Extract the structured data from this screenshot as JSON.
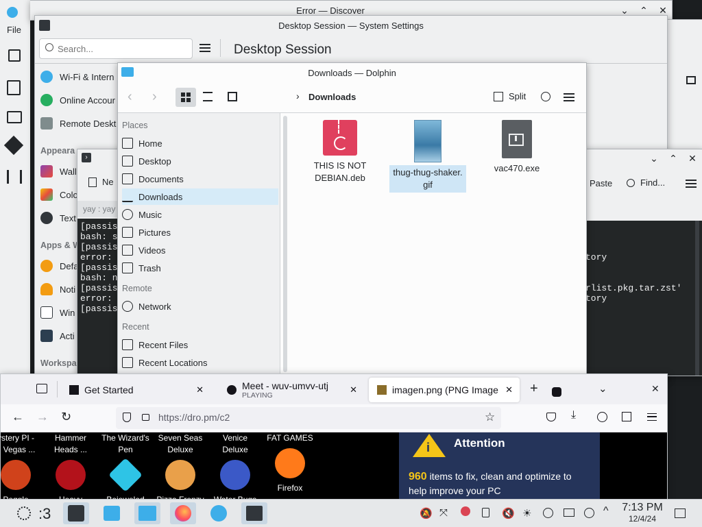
{
  "discover": {
    "title": "Error — Discover",
    "menu_file": "File"
  },
  "settings": {
    "title": "Desktop Session — System Settings",
    "search_placeholder": "Search...",
    "page_title": "Desktop Session",
    "items": [
      {
        "label": "Wi-Fi & Intern",
        "icon": "wifi-icon"
      },
      {
        "label": "Online Accour",
        "icon": "globe-icon"
      },
      {
        "label": "Remote Deskt",
        "icon": "remote-desktop-icon"
      }
    ],
    "section_appearance": "Appeara",
    "appearance_items": [
      {
        "label": "Wall",
        "icon": "wallpaper-icon"
      },
      {
        "label": "Colo",
        "icon": "colors-icon"
      },
      {
        "label": "Text",
        "icon": "text-icon"
      }
    ],
    "section_apps": "Apps & W",
    "apps_items": [
      {
        "label": "Defa",
        "icon": "star-icon"
      },
      {
        "label": "Noti",
        "icon": "bell-icon"
      },
      {
        "label": "Win",
        "icon": "window-icon"
      },
      {
        "label": "Acti",
        "icon": "activities-icon"
      }
    ],
    "section_workspace": "Workspa"
  },
  "konsole": {
    "new_tab": "Ne",
    "tab_label": "yay : yay",
    "lines": [
      "[passis",
      "bash: s",
      "[passis",
      "error: ",
      "[passis",
      "bash: n",
      "[passis",
      "error: ",
      "[passis"
    ]
  },
  "bg_terminal": {
    "paste": "Paste",
    "find": "Find...",
    "lines": [
      "tory",
      "rlist.pkg.tar.zst'",
      "tory"
    ]
  },
  "dolphin": {
    "title": "Downloads — Dolphin",
    "breadcrumb": "Downloads",
    "split": "Split",
    "places_heading": "Places",
    "places": [
      "Home",
      "Desktop",
      "Documents",
      "Downloads",
      "Music",
      "Pictures",
      "Videos",
      "Trash"
    ],
    "remote_heading": "Remote",
    "remote": [
      "Network"
    ],
    "recent_heading": "Recent",
    "recent": [
      "Recent Files",
      "Recent Locations"
    ],
    "files": [
      {
        "name": "THIS IS NOT DEBIAN.deb",
        "line1": "THIS IS NOT",
        "line2": "DEBIAN.deb",
        "icon": "deb-package-icon"
      },
      {
        "name": "thug-thug-shaker.gif",
        "line1": "thug-thug-shaker.",
        "line2": "gif",
        "icon": "gif-image-thumbnail"
      },
      {
        "name": "vac470.exe",
        "line1": "vac470.exe",
        "line2": "",
        "icon": "exe-file-icon"
      }
    ]
  },
  "firefox": {
    "tabs": [
      {
        "title": "Get Started",
        "subtitle": ""
      },
      {
        "title": "Meet - wuv-umvv-utj",
        "subtitle": "PLAYING"
      },
      {
        "title": "imagen.png (PNG Image",
        "subtitle": ""
      }
    ],
    "url": "https://dro.pm/c2",
    "tiles": [
      {
        "top1": "ystery PI -",
        "top2": "e Vegas ...",
        "bottom": "Peggle",
        "color": "#d0421b"
      },
      {
        "top1": "Hammer",
        "top2": "Heads ...",
        "bottom": "Heavy",
        "color": "#b3121b"
      },
      {
        "top1": "The Wizard's",
        "top2": "Pen",
        "bottom": "Bejeweled",
        "color": "#2ec4e6"
      },
      {
        "top1": "Seven Seas",
        "top2": "Deluxe",
        "bottom": "Pizza Frenzy",
        "color": "#e9a04a"
      },
      {
        "top1": "Venice",
        "top2": "Deluxe",
        "bottom": "Water Bugs",
        "color": "#3b59c7"
      },
      {
        "top1": "FAT GAMES",
        "top2": "",
        "bottom": "Firefox",
        "color": "#ff7a1a"
      }
    ],
    "attention": {
      "title": "Attention",
      "count": "960",
      "line1": " items to fix, clean and optimize to",
      "line2": "help improve your PC"
    }
  },
  "taskbar": {
    "activity": ":3",
    "time": "7:13 PM",
    "date": "12/4/24"
  },
  "colors": {
    "accent": "#3daee9",
    "selection": "#d6ebf8",
    "terminal_bg": "#232627",
    "attention_bg": "#25345a",
    "attention_yellow": "#f5c518"
  }
}
